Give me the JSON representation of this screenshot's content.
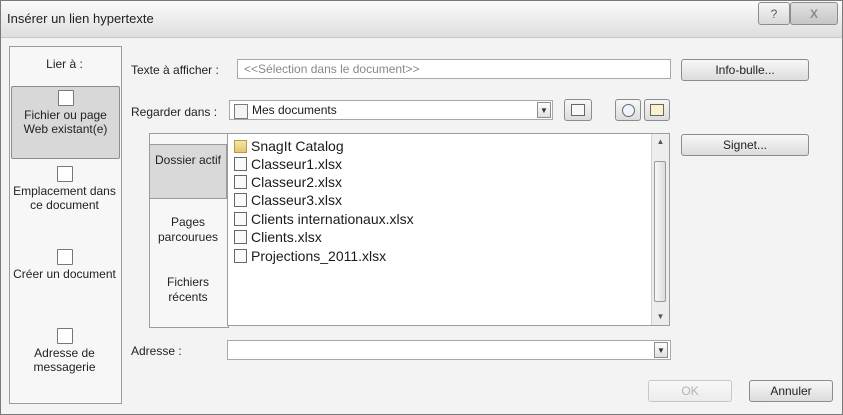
{
  "dialog": {
    "title": "Insérer un lien hypertexte",
    "help_label": "?",
    "close_label": "X"
  },
  "link_to": {
    "label": "Lier à :",
    "items": [
      {
        "label": "Fichier ou page Web existant(e)",
        "icon": "web-page-icon",
        "selected": true
      },
      {
        "label": "Emplacement dans ce document",
        "icon": "document-location-icon",
        "selected": false
      },
      {
        "label": "Créer un document",
        "icon": "new-document-icon",
        "selected": false
      },
      {
        "label": "Adresse de messagerie",
        "icon": "email-icon",
        "selected": false
      }
    ]
  },
  "text_to_display": {
    "label": "Texte à afficher :",
    "value": "<<Sélection dans le document>>"
  },
  "buttons": {
    "screentip": "Info-bulle...",
    "bookmark": "Signet...",
    "ok": "OK",
    "cancel": "Annuler"
  },
  "look_in": {
    "label": "Regarder dans :",
    "value": "Mes documents",
    "icons": [
      "folder-up-icon",
      "browse-web-icon",
      "browse-file-icon"
    ]
  },
  "look_panel": [
    {
      "label": "Dossier actif",
      "selected": true
    },
    {
      "label": "Pages parcourues",
      "selected": false
    },
    {
      "label": "Fichiers récents",
      "selected": false
    }
  ],
  "files": [
    {
      "name": "SnagIt Catalog",
      "type": "folder"
    },
    {
      "name": "Classeur1.xlsx",
      "type": "xlsx"
    },
    {
      "name": "Classeur2.xlsx",
      "type": "xlsx"
    },
    {
      "name": "Classeur3.xlsx",
      "type": "xlsx"
    },
    {
      "name": "Clients internationaux.xlsx",
      "type": "xlsx"
    },
    {
      "name": "Clients.xlsx",
      "type": "xlsx"
    },
    {
      "name": "Projections_2011.xlsx",
      "type": "xlsx"
    }
  ],
  "address": {
    "label": "Adresse :",
    "value": ""
  }
}
